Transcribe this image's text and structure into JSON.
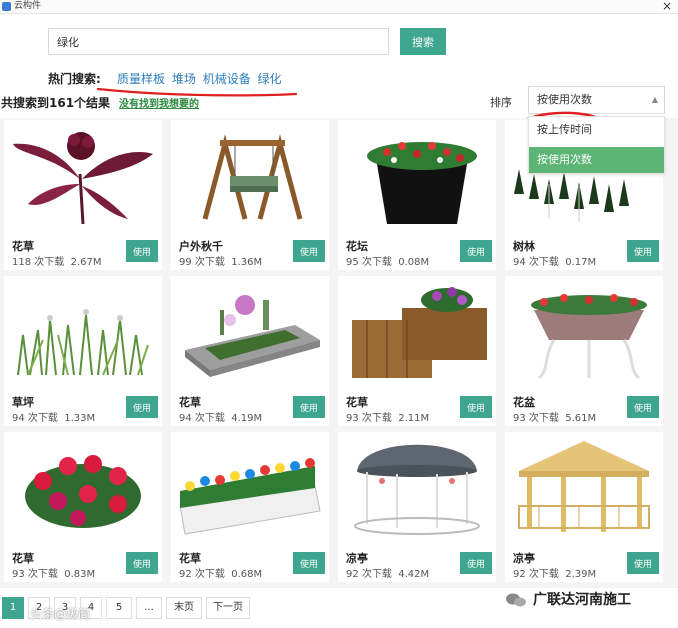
{
  "window": {
    "title": "云构件",
    "close_glyph": "×"
  },
  "search": {
    "value": "绿化",
    "button_label": "搜索"
  },
  "hot": {
    "label": "热门搜索:",
    "links": [
      "质量样板",
      "堆场",
      "机械设备",
      "绿化"
    ]
  },
  "results": {
    "count_text": "共搜索到161个结果",
    "not_found_link": "没有找到我想要的"
  },
  "sort": {
    "label": "排序",
    "selected": "按使用次数",
    "caret": "▲",
    "options": [
      "按上传时间",
      "按使用次数"
    ],
    "active_option_index": 1
  },
  "cards": [
    {
      "name": "花草",
      "downloads": "118 次下载",
      "size": "2.67M",
      "use_label": "使用",
      "icon": "flower-plant-icon"
    },
    {
      "name": "户外秋千",
      "downloads": "99 次下载",
      "size": "1.36M",
      "use_label": "使用",
      "icon": "swing-icon"
    },
    {
      "name": "花坛",
      "downloads": "95 次下载",
      "size": "0.08M",
      "use_label": "使用",
      "icon": "flower-bed-icon"
    },
    {
      "name": "树林",
      "downloads": "94 次下载",
      "size": "0.17M",
      "use_label": "使用",
      "icon": "forest-icon"
    },
    {
      "name": "草坪",
      "downloads": "94 次下载",
      "size": "1.33M",
      "use_label": "使用",
      "icon": "grass-icon"
    },
    {
      "name": "花草",
      "downloads": "94 次下载",
      "size": "4.19M",
      "use_label": "使用",
      "icon": "garden-plot-icon"
    },
    {
      "name": "花草",
      "downloads": "93 次下载",
      "size": "2.11M",
      "use_label": "使用",
      "icon": "wooden-planter-icon"
    },
    {
      "name": "花盆",
      "downloads": "93 次下载",
      "size": "5.61M",
      "use_label": "使用",
      "icon": "flower-pot-icon"
    },
    {
      "name": "花草",
      "downloads": "93 次下载",
      "size": "0.83M",
      "use_label": "使用",
      "icon": "red-flowers-icon"
    },
    {
      "name": "花草",
      "downloads": "92 次下载",
      "size": "0.68M",
      "use_label": "使用",
      "icon": "flower-box-icon"
    },
    {
      "name": "凉亭",
      "downloads": "92 次下载",
      "size": "4.42M",
      "use_label": "使用",
      "icon": "gazebo-dome-icon"
    },
    {
      "name": "凉亭",
      "downloads": "92 次下载",
      "size": "2.39M",
      "use_label": "使用",
      "icon": "gazebo-wood-icon"
    }
  ],
  "pager": {
    "pages": [
      "1",
      "2",
      "3",
      "4",
      "5",
      "...",
      "末页",
      "下一页"
    ],
    "active_index": 0
  },
  "watermarks": {
    "left": "头条@极简",
    "right": "广联达河南施工"
  },
  "colors": {
    "accent": "#3ea58f",
    "active_option": "#5cb574",
    "link": "#2f7fbf",
    "green_link": "#2b8a3e",
    "annotation": "#e02020"
  }
}
